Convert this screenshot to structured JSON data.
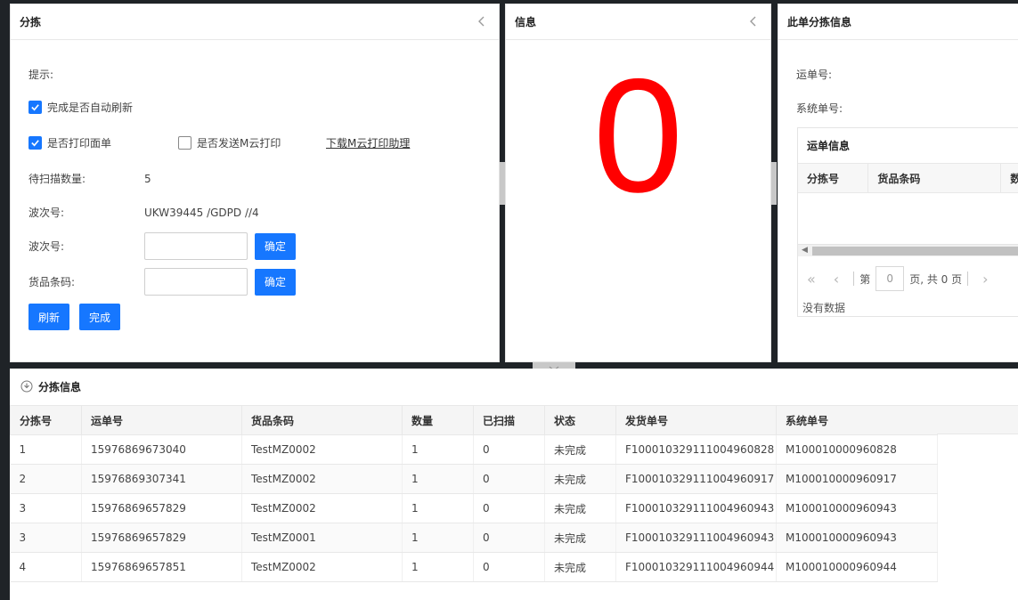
{
  "sort_panel": {
    "title": "分拣",
    "hint_label": "提示:",
    "auto_refresh_label": "完成是否自动刷新",
    "print_sheet_label": "是否打印面单",
    "send_cloud_label": "是否发送M云打印",
    "download_link": "下载M云打印助理",
    "pending_label": "待扫描数量:",
    "pending_value": "5",
    "wave_label": "波次号:",
    "wave_value": "UKW39445 /GDPD //4",
    "wave_input_label": "波次号:",
    "barcode_input_label": "货品条码:",
    "confirm_label": "确定",
    "refresh_label": "刷新",
    "complete_label": "完成"
  },
  "info_panel": {
    "title": "信息",
    "big_number": "0"
  },
  "detail_panel": {
    "title": "此单分拣信息",
    "waybill_label": "运单号:",
    "system_no_label": "系统单号:",
    "sub_title": "运单信息",
    "columns": [
      "分拣号",
      "货品条码",
      "数"
    ],
    "pager_page_label": "第",
    "pager_page_value": "0",
    "pager_total": "页, 共 0 页",
    "no_data": "没有数据"
  },
  "bottom_panel": {
    "title": "分拣信息",
    "columns": [
      "分拣号",
      "运单号",
      "货品条码",
      "数量",
      "已扫描",
      "状态",
      "发货单号",
      "系统单号"
    ],
    "rows": [
      [
        "1",
        "15976869673040",
        "TestMZ0002",
        "1",
        "0",
        "未完成",
        "F100010329111004960828",
        "M100010000960828"
      ],
      [
        "2",
        "15976869307341",
        "TestMZ0002",
        "1",
        "0",
        "未完成",
        "F100010329111004960917",
        "M100010000960917"
      ],
      [
        "3",
        "15976869657829",
        "TestMZ0002",
        "1",
        "0",
        "未完成",
        "F100010329111004960943",
        "M100010000960943"
      ],
      [
        "3",
        "15976869657829",
        "TestMZ0001",
        "1",
        "0",
        "未完成",
        "F100010329111004960943",
        "M100010000960943"
      ],
      [
        "4",
        "15976869657851",
        "TestMZ0002",
        "1",
        "0",
        "未完成",
        "F100010329111004960944",
        "M100010000960944"
      ]
    ]
  },
  "colors": {
    "accent": "#1677ff",
    "big_number": "#ff0000",
    "background": "#1f2327"
  },
  "icons": {
    "collapse": "chevron-left-icon",
    "check": "check-icon",
    "section": "circle-arrow-down-icon"
  }
}
